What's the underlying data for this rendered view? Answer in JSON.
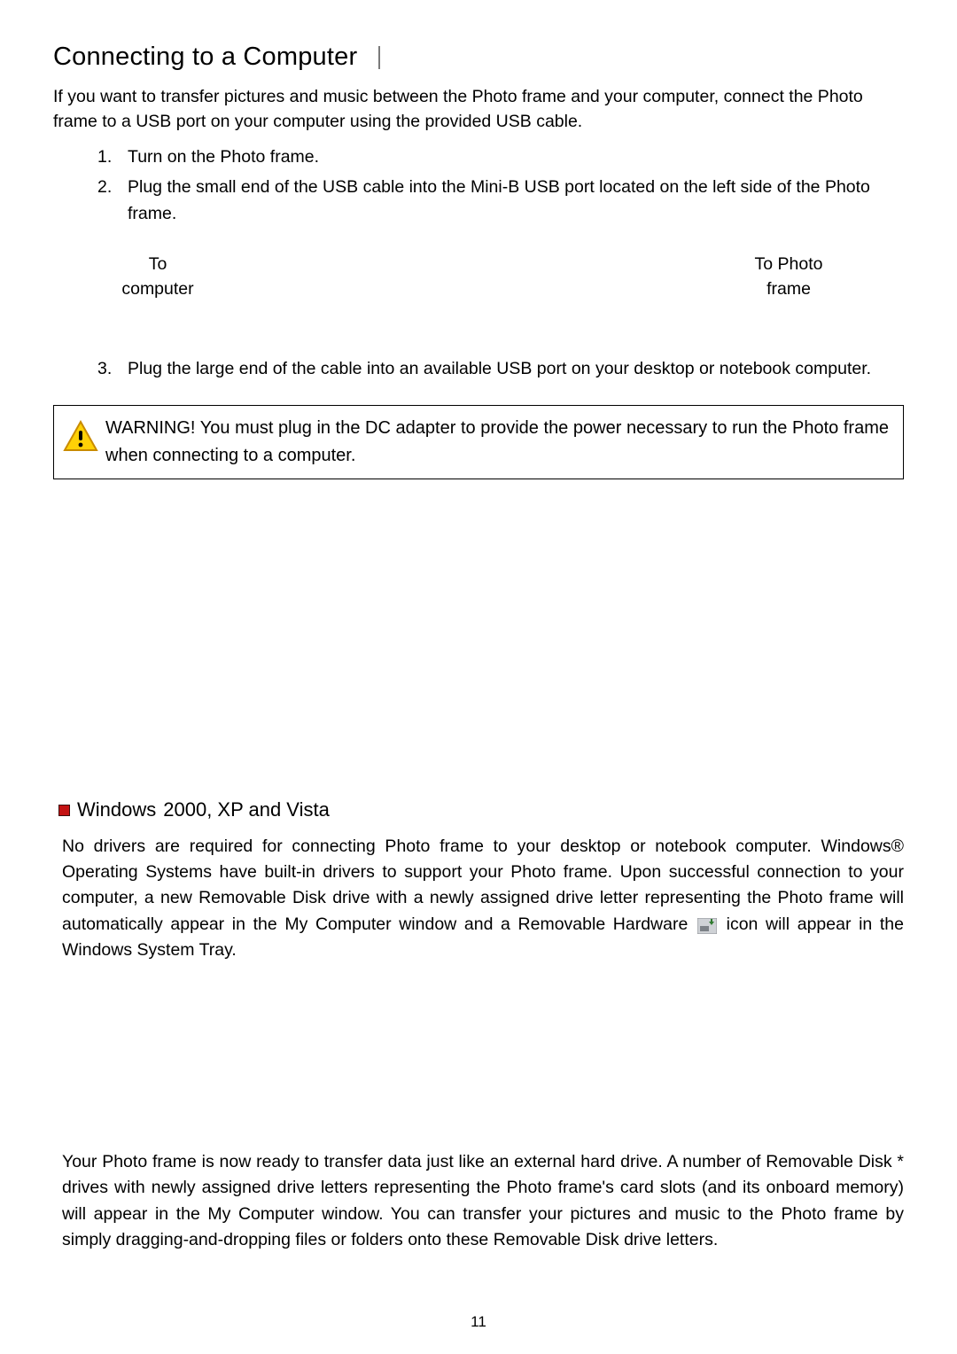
{
  "title": "Connecting to a Computer",
  "intro": "If you want to transfer pictures and music between the Photo frame and your computer, connect the Photo frame to a USB port on your computer using the provided USB cable.",
  "list": {
    "item1_num": "1.",
    "item1": "Turn on the Photo frame.",
    "item2_num": "2.",
    "item2": "Plug the small end of the USB cable into the Mini-B USB port located on the left side of the Photo frame.",
    "item3_num": "3.",
    "item3": "Plug the large end of the cable into an available USB port on your desktop or notebook computer."
  },
  "conn": {
    "left_line1": "To",
    "left_line2": "computer",
    "right_line1": "To Photo",
    "right_line2": "frame"
  },
  "warning": "WARNING! You must plug in the DC adapter to provide       the power necessary to run the Photo frame when connecting to a computer.",
  "windows_section": {
    "head_main": "Windows",
    "head_sup": "",
    "head_tail": "2000, XP and Vista",
    "para1_a": "No drivers are required for connecting Photo frame to your desktop or notebook computer. Windows® Operating Systems have built-in drivers to support your Photo frame. Upon successful connection to your computer, a new Removable Disk  drive with a newly assigned drive letter representing the Photo frame will automatically appear in the My Computer  window and a Removable Hardware ",
    "para1_b": " icon will appear in the Windows System Tray.",
    "para2": "Your Photo frame is now ready to transfer data just like an external hard drive. A number of Removable Disk * drives with newly assigned drive letters representing the Photo frame's card slots (and its onboard memory) will appear in the My Computer  window. You can transfer your pictures and music to the Photo frame by simply dragging-and-dropping files or folders onto these Removable Disk  drive letters."
  },
  "page_number": "11"
}
